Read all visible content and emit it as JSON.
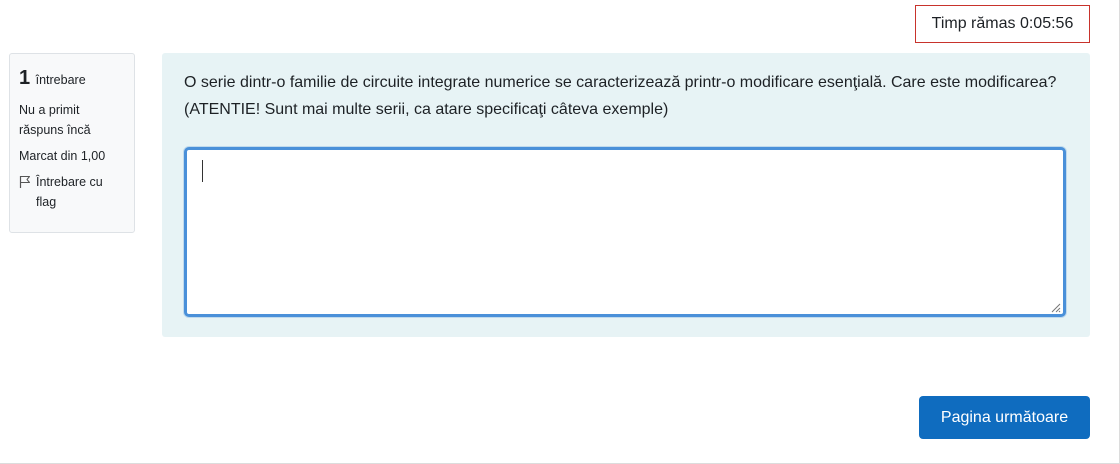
{
  "timer": {
    "label": "Timp rămas",
    "value": "0:05:56"
  },
  "question_info": {
    "number": "1",
    "number_label": "întrebare",
    "status": "Nu a primit răspuns încă",
    "marks": "Marcat din 1,00",
    "flag_label": "Întrebare cu flag",
    "flag_icon": "flag-outline-icon"
  },
  "question": {
    "text": "O serie dintr-o familie de circuite integrate numerice se caracterizează printr-o modificare esenţială. Care este modificarea? (ATENTIE! Sunt mai multe serii, ca atare specificaţi câteva exemple)",
    "answer_value": "",
    "answer_placeholder": ""
  },
  "navigation": {
    "next_label": "Pagina următoare"
  },
  "colors": {
    "timer_border": "#c8332c",
    "content_bg": "#e7f3f5",
    "input_focus_border": "#4a90d9",
    "primary_button": "#0f6cbf"
  }
}
